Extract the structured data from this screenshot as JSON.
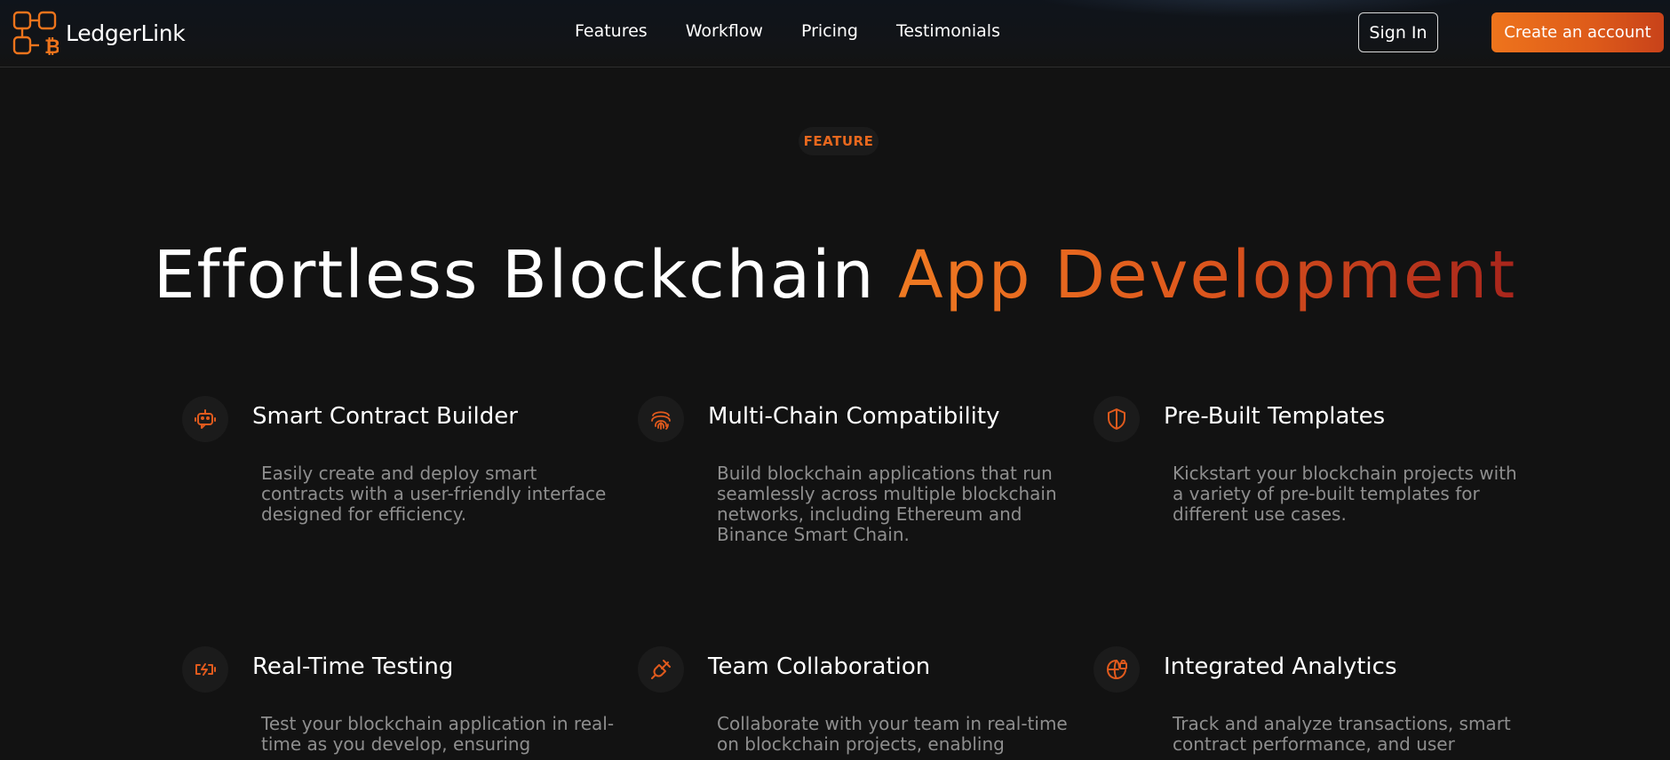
{
  "brand": {
    "name": "LedgerLink",
    "logo_icon": "blockchain-bitcoin-logo-icon",
    "accent_color": "#ee741c"
  },
  "nav": {
    "links": [
      {
        "label": "Features"
      },
      {
        "label": "Workflow"
      },
      {
        "label": "Pricing"
      },
      {
        "label": "Testimonials"
      }
    ],
    "sign_in_label": "Sign In",
    "create_account_label": "Create an account"
  },
  "hero": {
    "badge": "FEATURE",
    "title_plain": "Effortless Blockchain ",
    "title_accent": "App Development"
  },
  "features": [
    {
      "icon": "robot-icon",
      "title": "Smart Contract Builder",
      "description": "Easily create and deploy smart contracts with a user-friendly interface designed for efficiency."
    },
    {
      "icon": "fingerprint-icon",
      "title": "Multi-Chain Compatibility",
      "description": "Build blockchain applications that run seamlessly across multiple blockchain networks, including Ethereum and Binance Smart Chain."
    },
    {
      "icon": "shield-icon",
      "title": "Pre-Built Templates",
      "description": "Kickstart your blockchain projects with a variety of pre-built templates for different use cases."
    },
    {
      "icon": "battery-charging-icon",
      "title": "Real-Time Testing",
      "description": "Test your blockchain application in real-time as you develop, ensuring"
    },
    {
      "icon": "plug-icon",
      "title": "Team Collaboration",
      "description": "Collaborate with your team in real-time on blockchain projects, enabling"
    },
    {
      "icon": "globe-lock-icon",
      "title": "Integrated Analytics",
      "description": "Track and analyze transactions, smart contract performance, and user"
    }
  ],
  "colors": {
    "background": "#121212",
    "accent_orange": "#ee741c",
    "accent_red": "#a8251c",
    "muted_text": "#8e8e8e"
  }
}
